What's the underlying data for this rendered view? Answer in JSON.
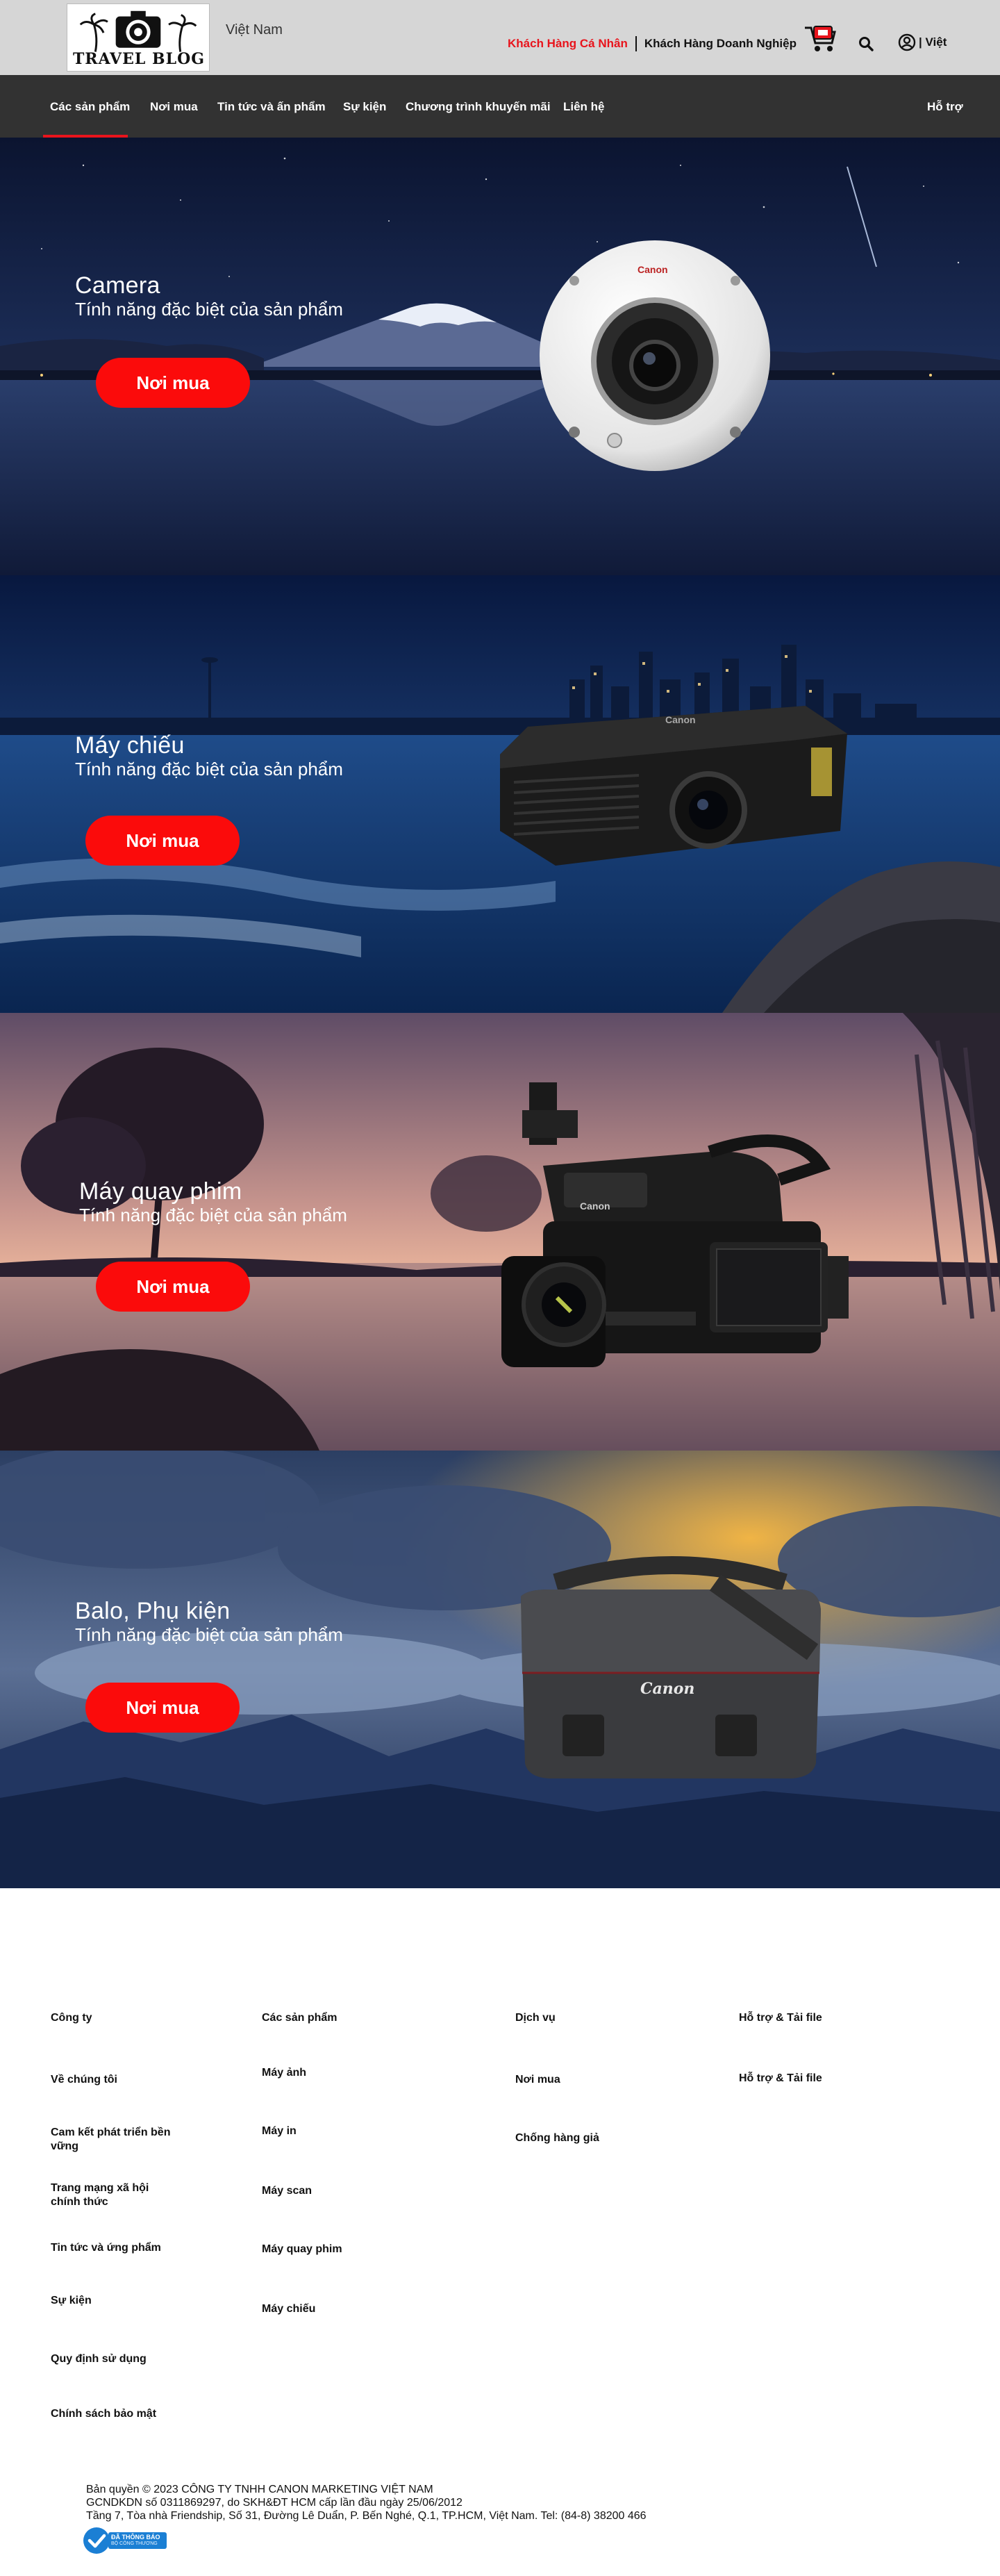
{
  "header": {
    "logo_text": "TRAVEL BLOG",
    "country": "Việt Nam",
    "personal_label": "Khách Hàng Cá Nhân",
    "business_label": "Khách Hàng Doanh Nghiệp",
    "language_label": "| Việt"
  },
  "nav": {
    "items": [
      {
        "label": "Các sản phẩm",
        "active": true
      },
      {
        "label": "Nơi mua"
      },
      {
        "label": "Tin tức và ấn phẩm"
      },
      {
        "label": "Sự kiện"
      },
      {
        "label": "Chương trình khuyến mãi"
      },
      {
        "label": "Liên hệ"
      }
    ],
    "support_label": "Hỗ trợ"
  },
  "heroes": [
    {
      "title": "Camera",
      "subtitle": "Tính năng đặc biệt của sản phẩm",
      "button": "Nơi mua",
      "product_brand": "Canon"
    },
    {
      "title": "Máy chiếu",
      "subtitle": "Tính năng đặc biệt của sản phẩm",
      "button": "Nơi mua",
      "product_brand": "Canon"
    },
    {
      "title": "Máy quay phim",
      "subtitle": "Tính năng đặc biệt của sản phẩm",
      "button": "Nơi mua",
      "product_brand": "Canon"
    },
    {
      "title": "Balo, Phụ kiện",
      "subtitle": "Tính năng đặc biệt của sản phẩm",
      "button": "Nơi mua",
      "product_brand": "Canon"
    }
  ],
  "footer": {
    "columns": [
      {
        "title": "Công ty",
        "links": [
          "Về  chúng tôi",
          "Cam kết phát triển  bền vững",
          "Trang mạng xã hội chính thức",
          "Tin tức và ứng phẩm",
          "Sự kiện",
          "Quy định sử dụng",
          "Chính sách bảo mật"
        ]
      },
      {
        "title": "Các sản phẩm",
        "links": [
          "Máy ảnh",
          "Máy in",
          "Máy scan",
          "Máy quay phim",
          "Máy chiếu"
        ]
      },
      {
        "title": "Dịch vụ",
        "links": [
          "Nơi mua",
          "Chống hàng giả"
        ]
      },
      {
        "title": "Hỗ trợ  & Tải file",
        "links": [
          "Hỗ trợ  & Tải file"
        ]
      }
    ],
    "copyright": [
      "Bản quyền © 2023 CÔNG TY TNHH CANON MARKETING VIỆT NAM",
      "GCNDKDN số 0311869297, do SKH&ĐT HCM cấp lần đầu ngày 25/06/2012",
      "Tầng 7, Tòa nhà Friendship, Số 31, Đường Lê Duẩn, P. Bến Nghé, Q.1, TP.HCM, Việt Nam. Tel: (84-8) 38200 466"
    ],
    "badge_text": "ĐÃ THÔNG BÁO",
    "badge_sub": "BỘ CÔNG THƯƠNG"
  },
  "colors": {
    "accent_red": "#e8141c",
    "button_red": "#fb0b0b",
    "nav_bg": "#323232",
    "topbar_bg": "#d6d6d6"
  }
}
